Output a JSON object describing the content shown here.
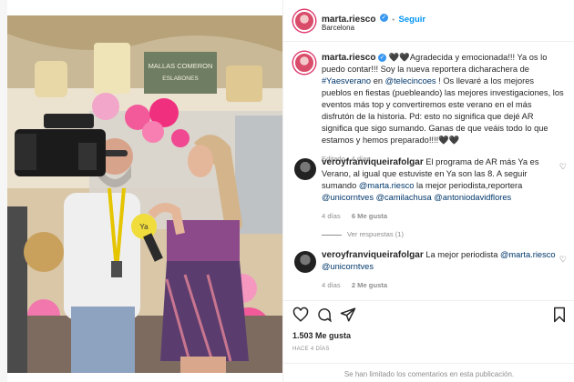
{
  "post_header": {
    "username": "marta.riesco",
    "follow_label": "Seguir",
    "location": "Barcelona",
    "dot": "•"
  },
  "caption": {
    "username": "marta.riesco",
    "text_1": "🖤🖤Agradecida y emocionada!!! Ya os lo puedo contar!!! Soy la nueva reportera dicharachera de ",
    "hashtag": "#Yaesverano",
    "text_2": " en ",
    "mention": "@telecincoes",
    "text_3": " ! Os llevaré a los mejores pueblos en fiestas (puebleando) las mejores investigaciones, los eventos más top y convertiremos este verano en el más disfrutón de la historia. Pd: esto no significa que dejé AR significa que sigo sumando. Ganas de que veáis todo lo que estamos y hemos preparado!!!!🖤🖤",
    "time": "Editado · 4 días"
  },
  "comments": [
    {
      "username": "veroyfranviqueirafolgar",
      "text_1": " El programa de AR más Ya es Verano, al igual que estuviste en Ya son las 8. A seguir sumando ",
      "mention_1": "@marta.riesco",
      "text_2": " la mejor periodista,reportera ",
      "mention_2": "@unicorntves",
      "text_3": " ",
      "mention_3": "@camilachusa",
      "text_4": " ",
      "mention_4": "@antoniodavidflores",
      "time": "4 días",
      "likes": "6 Me gusta",
      "replies": "Ver respuestas (1)"
    },
    {
      "username": "veroyfranviqueirafolgar",
      "text_1": " La mejor periodista ",
      "mention_1": "@marta.riesco",
      "text_2": " ",
      "mention_2": "@unicorntves",
      "time": "4 días",
      "likes": "2 Me gusta"
    }
  ],
  "actions": {
    "likes": "1.503 Me gusta",
    "time_ago": "HACE 4 DÍAS",
    "comments_limited": "Se han limitado los comentarios en esta publicación."
  },
  "photo": {
    "sign_1": "MALLAS COMERON",
    "sign_2": "ESLABONES",
    "mic_text": "Ya"
  },
  "colors": {
    "accent": "#0095f6",
    "link": "#00376b",
    "muted": "#8e8e8e"
  },
  "icons": [
    "heart-icon",
    "comment-icon",
    "share-icon",
    "bookmark-icon",
    "verified-icon",
    "small-heart-icon"
  ]
}
